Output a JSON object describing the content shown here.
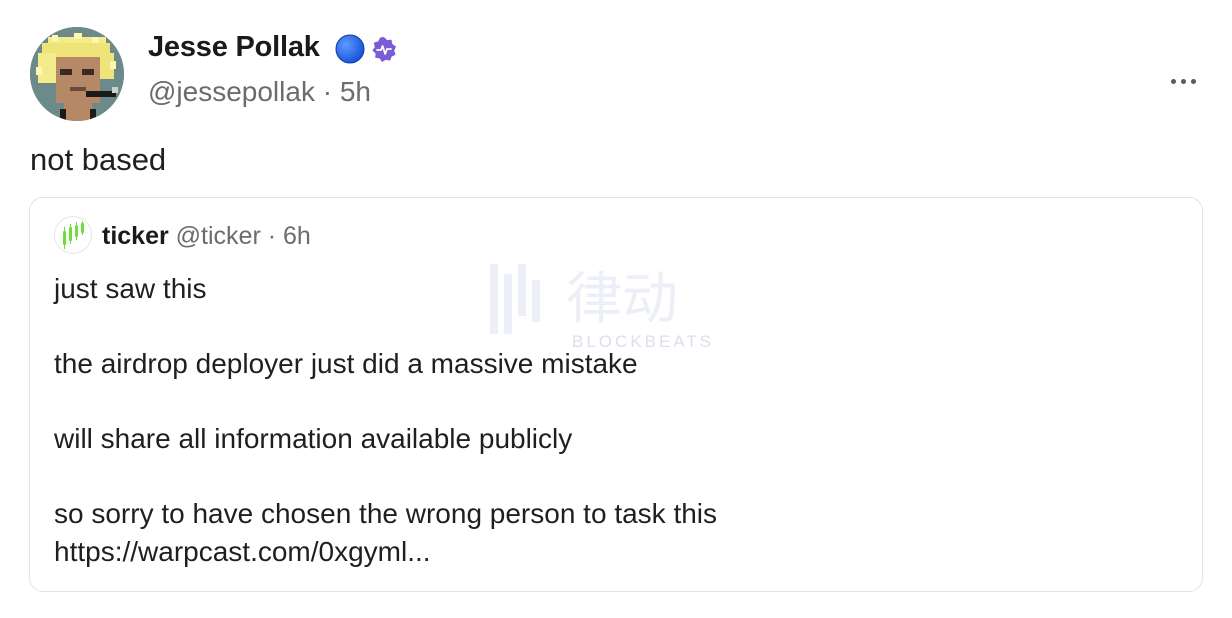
{
  "post": {
    "author_name": "Jesse Pollak",
    "handle": "@jessepollak",
    "separator": "·",
    "time": "5h",
    "text": "not based",
    "badges": [
      "blue-circle-icon",
      "power-badge-icon"
    ],
    "more_icon": "more-horizontal-icon"
  },
  "quote": {
    "author_name": "ticker",
    "handle": "@ticker",
    "separator": "·",
    "time": "6h",
    "lines": [
      "just saw this",
      "the airdrop deployer just did a massive mistake",
      "will share all information available publicly",
      "so sorry to have chosen the wrong person to task this",
      "https://warpcast.com/0xgyml..."
    ]
  },
  "watermark": {
    "glyphs": "律动",
    "text": "BLOCKBEATS"
  },
  "colors": {
    "handle_gray": "#6b6b70",
    "border": "#e3e3e6",
    "badge_blue": "#1d63e8",
    "badge_purple": "#7c5bd6",
    "ticker_green": "#6fdc3f"
  }
}
